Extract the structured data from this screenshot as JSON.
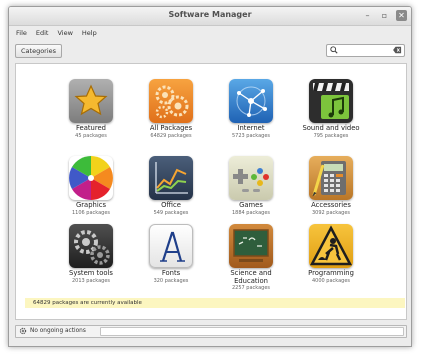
{
  "window": {
    "title": "Software Manager",
    "controls": [
      "minimize",
      "maximize",
      "close"
    ]
  },
  "menu": [
    "File",
    "Edit",
    "View",
    "Help"
  ],
  "toolbar": {
    "categories_label": "Categories",
    "search_value": ""
  },
  "categories": [
    {
      "name": "Featured",
      "count": "45 packages",
      "icon": "star-icon"
    },
    {
      "name": "All Packages",
      "count": "64829 packages",
      "icon": "gears-icon"
    },
    {
      "name": "Internet",
      "count": "5723 packages",
      "icon": "network-icon"
    },
    {
      "name": "Sound and video",
      "count": "795 packages",
      "icon": "media-icon"
    },
    {
      "name": "Graphics",
      "count": "1106 packages",
      "icon": "color-wheel-icon"
    },
    {
      "name": "Office",
      "count": "549 packages",
      "icon": "chart-icon"
    },
    {
      "name": "Games",
      "count": "1884 packages",
      "icon": "gamepad-icon"
    },
    {
      "name": "Accessories",
      "count": "3092 packages",
      "icon": "calculator-icon"
    },
    {
      "name": "System tools",
      "count": "2013 packages",
      "icon": "system-gears-icon"
    },
    {
      "name": "Fonts",
      "count": "320 packages",
      "icon": "font-icon"
    },
    {
      "name": "Science and Education",
      "count": "2257 packages",
      "icon": "chalkboard-icon"
    },
    {
      "name": "Programming",
      "count": "4000 packages",
      "icon": "construction-icon"
    }
  ],
  "info_text": "64829 packages are currently available",
  "status": {
    "text": "No ongoing actions"
  }
}
